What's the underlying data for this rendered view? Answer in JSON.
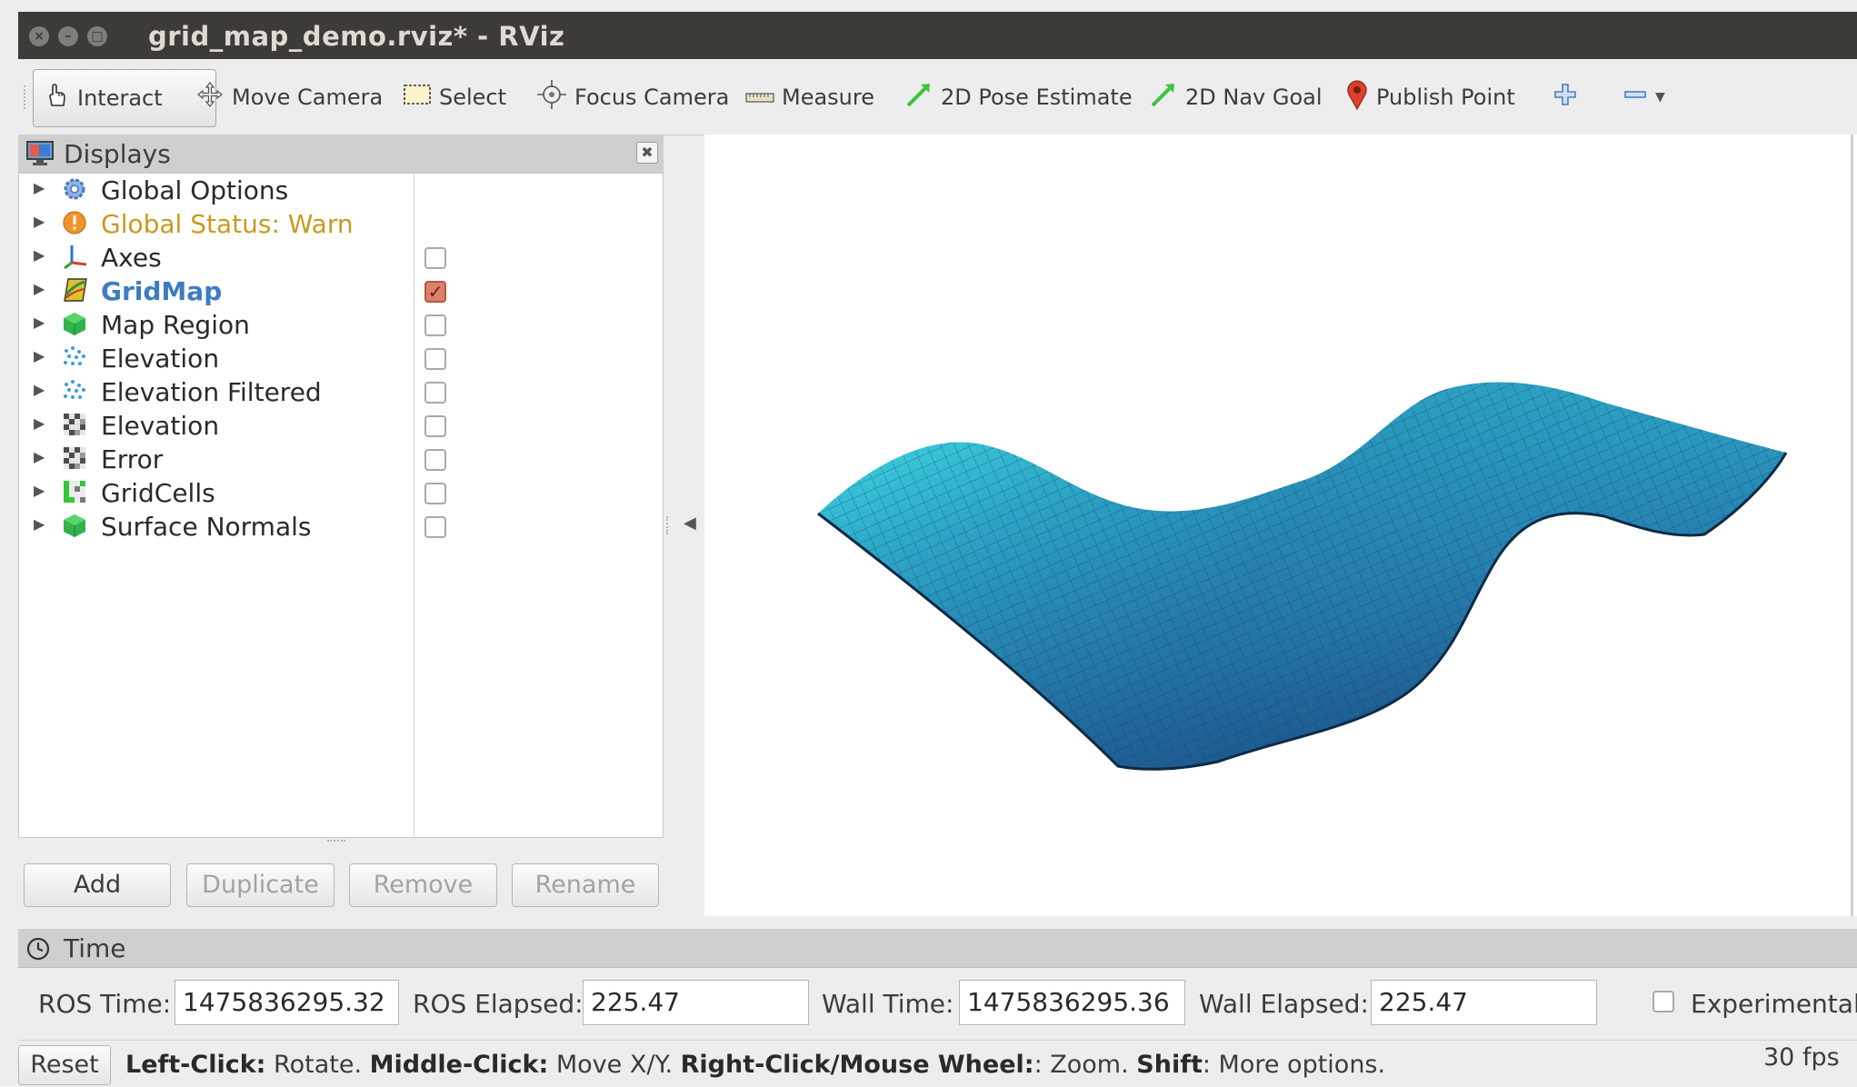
{
  "window": {
    "title": "grid_map_demo.rviz* - RViz",
    "controls": [
      "close-icon",
      "minimize-icon",
      "maximize-icon"
    ]
  },
  "toolbar": {
    "tools": [
      {
        "label": "Interact",
        "icon": "hand-pointer-icon",
        "active": true
      },
      {
        "label": "Move Camera",
        "icon": "move-arrows-icon"
      },
      {
        "label": "Select",
        "icon": "selection-rect-icon"
      },
      {
        "label": "Focus Camera",
        "icon": "crosshair-icon"
      },
      {
        "label": "Measure",
        "icon": "ruler-icon"
      },
      {
        "label": "2D Pose Estimate",
        "icon": "green-arrow-icon"
      },
      {
        "label": "2D Nav Goal",
        "icon": "green-arrow-icon"
      },
      {
        "label": "Publish Point",
        "icon": "map-pin-icon"
      }
    ],
    "add_tool_icon": "plus-icon",
    "remove_tool_icon": "minus-icon"
  },
  "displays": {
    "title": "Displays",
    "items": [
      {
        "label": "Global Options",
        "icon": "gear-icon",
        "checkbox": null
      },
      {
        "label": "Global Status: Warn",
        "icon": "warning-icon",
        "status": "warn",
        "checkbox": null
      },
      {
        "label": "Axes",
        "icon": "axes-icon",
        "checkbox": false
      },
      {
        "label": "GridMap",
        "icon": "gridmap-icon",
        "checkbox": true,
        "selected": true
      },
      {
        "label": "Map Region",
        "icon": "green-cube-icon",
        "checkbox": false
      },
      {
        "label": "Elevation",
        "icon": "point-cloud-icon",
        "checkbox": false
      },
      {
        "label": "Elevation Filtered",
        "icon": "point-cloud-icon",
        "checkbox": false
      },
      {
        "label": "Elevation",
        "icon": "occupancy-grid-icon",
        "checkbox": false
      },
      {
        "label": "Error",
        "icon": "occupancy-grid-icon",
        "checkbox": false
      },
      {
        "label": "GridCells",
        "icon": "grid-cells-icon",
        "checkbox": false
      },
      {
        "label": "Surface Normals",
        "icon": "green-cube-icon",
        "checkbox": false
      }
    ],
    "buttons": {
      "add": "Add",
      "duplicate": "Duplicate",
      "remove": "Remove",
      "rename": "Rename"
    }
  },
  "time": {
    "title": "Time",
    "ros_time_label": "ROS Time:",
    "ros_time": "1475836295.32",
    "ros_elapsed_label": "ROS Elapsed:",
    "ros_elapsed": "225.47",
    "wall_time_label": "Wall Time:",
    "wall_time": "1475836295.36",
    "wall_elapsed_label": "Wall Elapsed:",
    "wall_elapsed": "225.47",
    "experimental_label": "Experimental"
  },
  "status": {
    "reset": "Reset",
    "help_1b": "Left-Click:",
    "help_1": " Rotate. ",
    "help_2b": "Middle-Click:",
    "help_2": " Move X/Y. ",
    "help_3b": "Right-Click/Mouse Wheel:",
    "help_3": ": Zoom. ",
    "help_4b": "Shift",
    "help_4": ": More options.",
    "fps": "30 fps"
  },
  "colors": {
    "surface_light": "#3fe6ea",
    "surface_dark": "#1f5f8c",
    "warn": "#c89a1e",
    "selected": "#3b7cc4"
  }
}
